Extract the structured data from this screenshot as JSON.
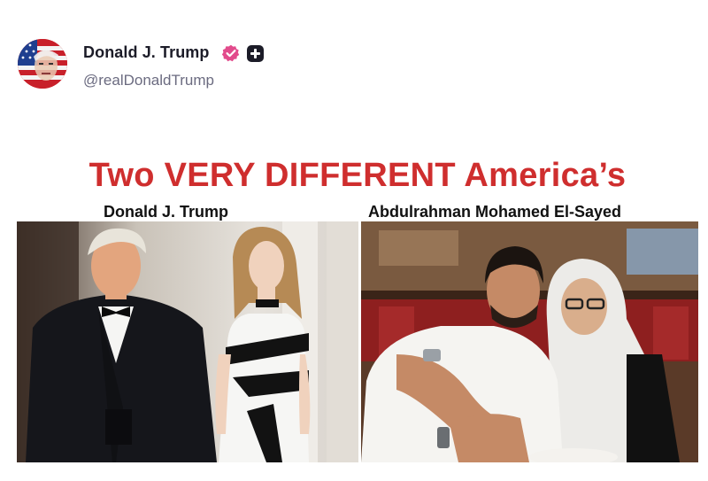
{
  "post": {
    "author_name": "Donald J. Trump",
    "handle": "@realDonaldTrump",
    "verified_icon": "verified-badge-icon",
    "plus_icon": "plus-icon"
  },
  "meme": {
    "headline": "Two VERY DIFFERENT America’s",
    "left_caption": "Donald J. Trump",
    "right_caption": "Abdulrahman Mohamed El-Sayed"
  },
  "colors": {
    "headline": "#cf2e2e",
    "verified": "#e24b8c",
    "text_primary": "#1c1c28",
    "text_secondary": "#6b6b80"
  }
}
